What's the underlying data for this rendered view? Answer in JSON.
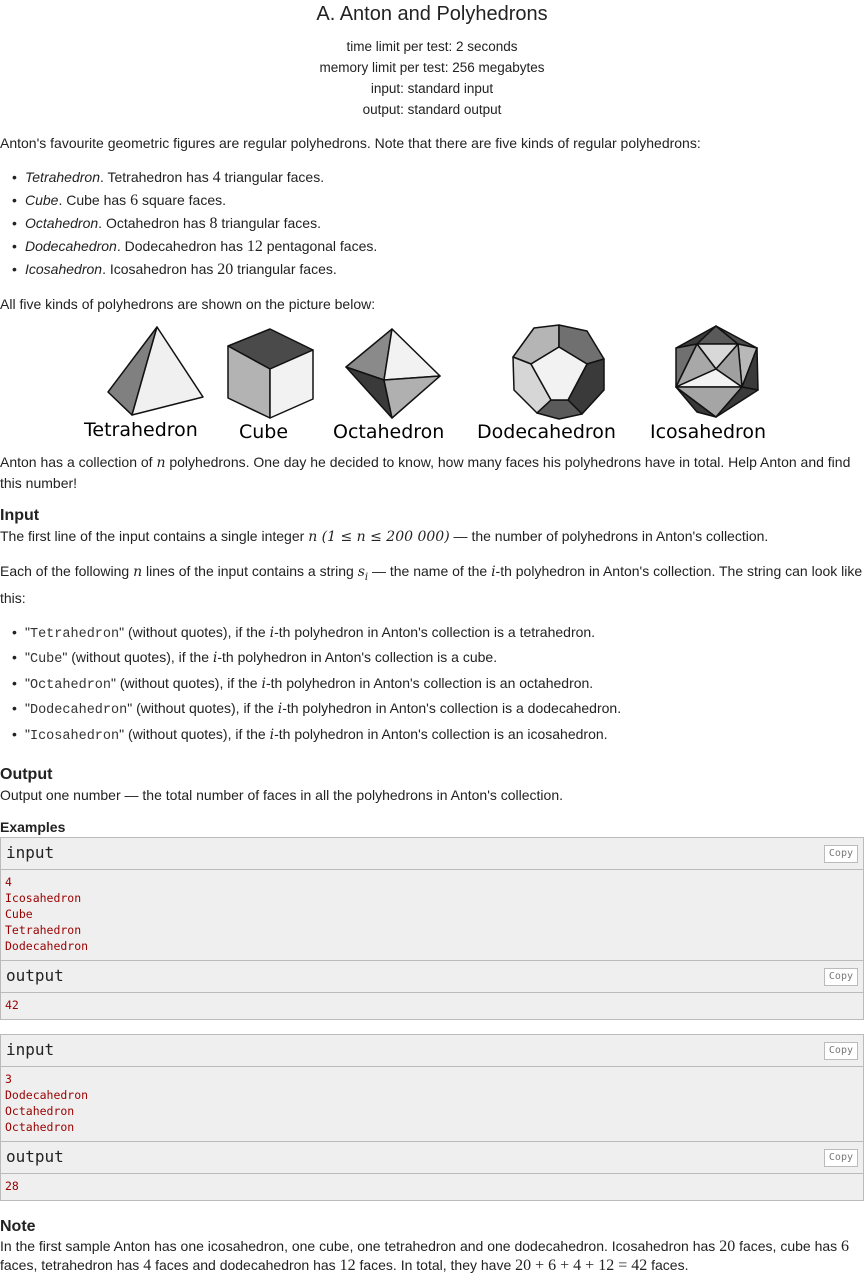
{
  "problem": {
    "title": "A. Anton and Polyhedrons",
    "time_limit": "time limit per test: 2 seconds",
    "memory_limit": "memory limit per test: 256 megabytes",
    "input_file": "input: standard input",
    "output_file": "output: standard output"
  },
  "statement": {
    "intro": "Anton's favourite geometric figures are regular polyhedrons. Note that there are five kinds of regular polyhedrons:",
    "kinds": [
      {
        "name": "Tetrahedron",
        "pre": ". Tetrahedron has ",
        "num": "4",
        "post": " triangular faces."
      },
      {
        "name": "Cube",
        "pre": ". Cube has ",
        "num": "6",
        "post": " square faces."
      },
      {
        "name": "Octahedron",
        "pre": ". Octahedron has ",
        "num": "8",
        "post": " triangular faces."
      },
      {
        "name": "Dodecahedron",
        "pre": ". Dodecahedron has ",
        "num": "12",
        "post": " pentagonal faces."
      },
      {
        "name": "Icosahedron",
        "pre": ". Icosahedron has ",
        "num": "20",
        "post": " triangular faces."
      }
    ],
    "shown": "All five kinds of polyhedrons are shown on the picture below:",
    "figure_labels": [
      "Tetrahedron",
      "Cube",
      "Octahedron",
      "Dodecahedron",
      "Icosahedron"
    ],
    "collection_a": "Anton has a collection of ",
    "collection_n": "n",
    "collection_b": " polyhedrons. One day he decided to know, how many faces his polyhedrons have in total. Help Anton and find this number!"
  },
  "input_spec": {
    "heading": "Input",
    "line1_a": "The first line of the input contains a single integer ",
    "line1_math": "n (1 ≤ n ≤ 200 000)",
    "line1_b": " — the number of polyhedrons in Anton's collection.",
    "line2_a": "Each of the following ",
    "line2_n": "n",
    "line2_b": " lines of the input contains a string ",
    "line2_s": "s",
    "line2_sub": "i",
    "line2_c": " — the name of the ",
    "line2_i": "i",
    "line2_d": "-th polyhedron in Anton's collection. The string can look like this:",
    "options": [
      {
        "code": "Tetrahedron",
        "mid": "\" (without quotes), if the ",
        "i": "i",
        "post": "-th polyhedron in Anton's collection is a tetrahedron."
      },
      {
        "code": "Cube",
        "mid": "\" (without quotes), if the ",
        "i": "i",
        "post": "-th polyhedron in Anton's collection is a cube."
      },
      {
        "code": "Octahedron",
        "mid": "\" (without quotes), if the ",
        "i": "i",
        "post": "-th polyhedron in Anton's collection is an octahedron."
      },
      {
        "code": "Dodecahedron",
        "mid": "\" (without quotes), if the ",
        "i": "i",
        "post": "-th polyhedron in Anton's collection is a dodecahedron."
      },
      {
        "code": "Icosahedron",
        "mid": "\" (without quotes), if the ",
        "i": "i",
        "post": "-th polyhedron in Anton's collection is an icosahedron."
      }
    ]
  },
  "output_spec": {
    "heading": "Output",
    "text": "Output one number — the total number of faces in all the polyhedrons in Anton's collection."
  },
  "examples": {
    "heading": "Examples",
    "input_label": "input",
    "output_label": "output",
    "copy_label": "Copy",
    "tests": [
      {
        "input": "4\nIcosahedron\nCube\nTetrahedron\nDodecahedron",
        "output": "42"
      },
      {
        "input": "3\nDodecahedron\nOctahedron\nOctahedron",
        "output": "28"
      }
    ]
  },
  "note": {
    "heading": "Note",
    "t1": "In the first sample Anton has one icosahedron, one cube, one tetrahedron and one dodecahedron. Icosahedron has ",
    "n1": "20",
    "t2": " faces, cube has ",
    "n2": "6",
    "t3": " faces, tetrahedron has ",
    "n3": "4",
    "t4": " faces and dodecahedron has ",
    "n4": "12",
    "t5": " faces. In total, they have ",
    "eq": "20 + 6 + 4 + 12 = 42",
    "t6": " faces."
  }
}
